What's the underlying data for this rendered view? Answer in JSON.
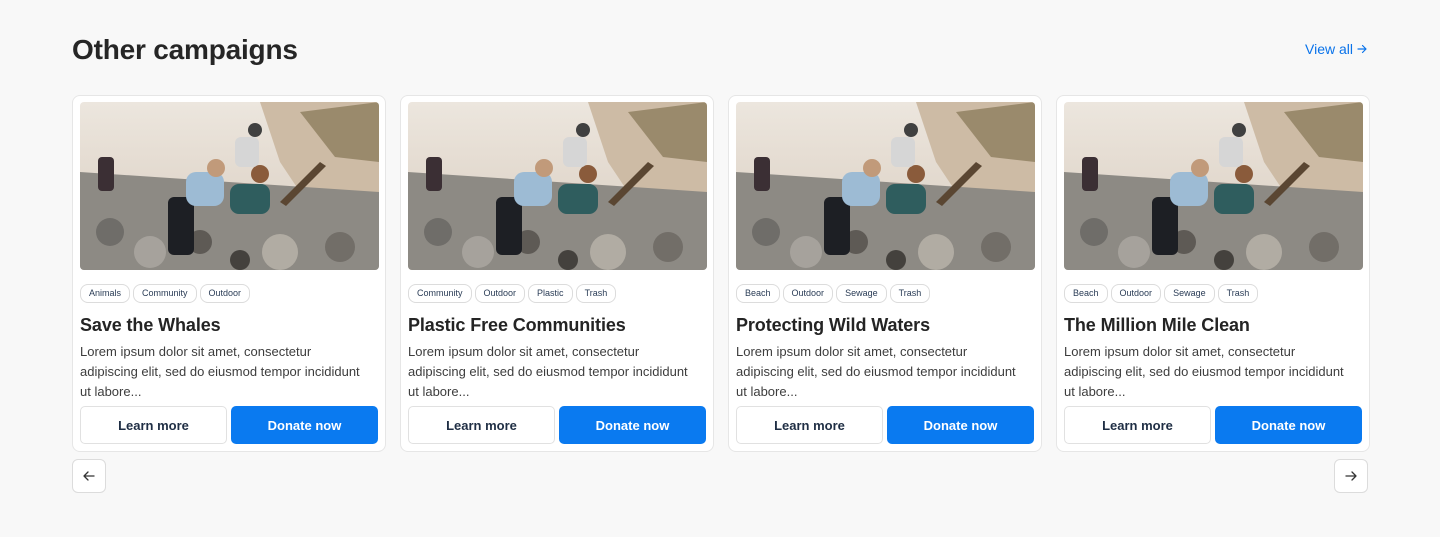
{
  "header": {
    "title": "Other campaigns",
    "view_all": "View all"
  },
  "campaigns": [
    {
      "tags": [
        "Animals",
        "Community",
        "Outdoor"
      ],
      "title": "Save the Whales",
      "description": "Lorem ipsum dolor sit amet, consectetur adipiscing elit, sed do eiusmod tempor incididunt ut labore...",
      "learn_more": "Learn more",
      "donate": "Donate now"
    },
    {
      "tags": [
        "Community",
        "Outdoor",
        "Plastic",
        "Trash"
      ],
      "title": "Plastic Free Communities",
      "description": "Lorem ipsum dolor sit amet, consectetur adipiscing elit, sed do eiusmod tempor incididunt ut labore...",
      "learn_more": "Learn more",
      "donate": "Donate now"
    },
    {
      "tags": [
        "Beach",
        "Outdoor",
        "Sewage",
        "Trash"
      ],
      "title": "Protecting Wild Waters",
      "description": "Lorem ipsum dolor sit amet, consectetur adipiscing elit, sed do eiusmod tempor incididunt ut labore...",
      "learn_more": "Learn more",
      "donate": "Donate now"
    },
    {
      "tags": [
        "Beach",
        "Outdoor",
        "Sewage",
        "Trash"
      ],
      "title": "The Million Mile Clean",
      "description": "Lorem ipsum dolor sit amet, consectetur adipiscing elit, sed do eiusmod tempor incididunt ut labore...",
      "learn_more": "Learn more",
      "donate": "Donate now"
    }
  ],
  "carousel": {
    "prev_icon": "arrow-left-icon",
    "next_icon": "arrow-right-icon"
  },
  "colors": {
    "accent": "#0a7af0",
    "link": "#0a73ea",
    "background": "#f8f8f8"
  }
}
